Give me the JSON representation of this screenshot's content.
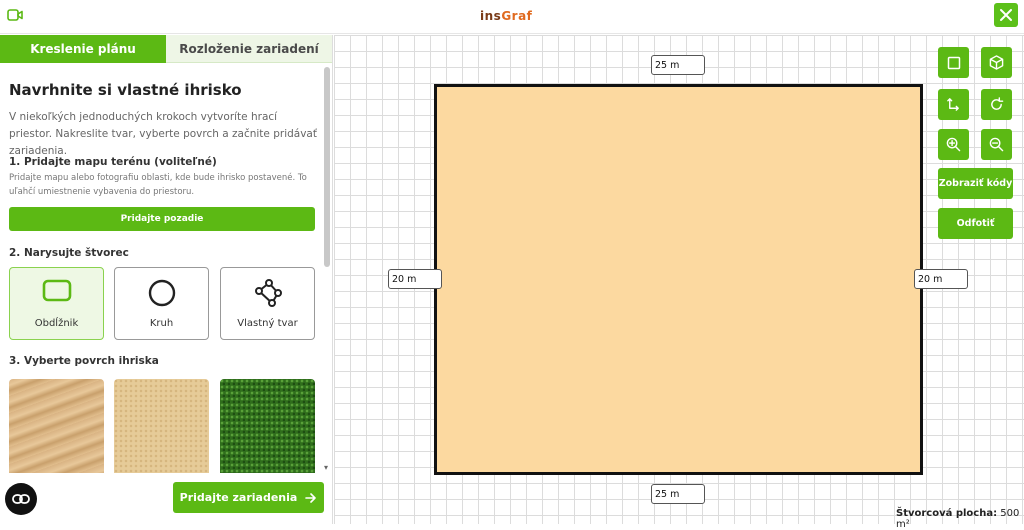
{
  "header": {
    "logo_part1": "ins",
    "logo_part2": "Graf"
  },
  "tabs": [
    {
      "label": "Kreslenie plánu",
      "active": true
    },
    {
      "label": "Rozloženie zariadení",
      "active": false
    }
  ],
  "panel": {
    "title": "Navrhnite si vlastné ihrisko",
    "intro": "V niekoľkých jednoduchých krokoch vytvoríte hrací priestor. Nakreslite tvar, vyberte povrch a začnite pridávať zariadenia.",
    "step1_title": "1. Pridajte mapu terénu (voliteľné)",
    "step1_text": "Pridajte mapu alebo fotografiu oblasti, kde bude ihrisko postavené. To uľahčí umiestnenie vybavenia do priestoru.",
    "step1_button": "Pridajte pozadie",
    "step2_title": "2. Narysujte štvorec",
    "shapes": [
      {
        "label": "Obdĺžnik",
        "icon": "rectangle-icon",
        "selected": true
      },
      {
        "label": "Kruh",
        "icon": "circle-icon",
        "selected": false
      },
      {
        "label": "Vlastný tvar",
        "icon": "polygon-icon",
        "selected": false
      }
    ],
    "step3_title": "3. Vyberte povrch ihriska",
    "surfaces": [
      "sand-texture",
      "fine-sand-texture",
      "grass-texture"
    ],
    "add_devices_button": "Pridajte zariadenia"
  },
  "canvas": {
    "dim_top": "25 m",
    "dim_bottom": "25 m",
    "dim_left": "20 m",
    "dim_right": "20 m",
    "field_color": "#fcd9a0",
    "show_codes_button": "Zobraziť kódy",
    "photo_button": "Odfotiť",
    "area_label": "Štvorcová plocha:",
    "area_value": "500 m²"
  },
  "colors": {
    "accent": "#5cb914"
  }
}
